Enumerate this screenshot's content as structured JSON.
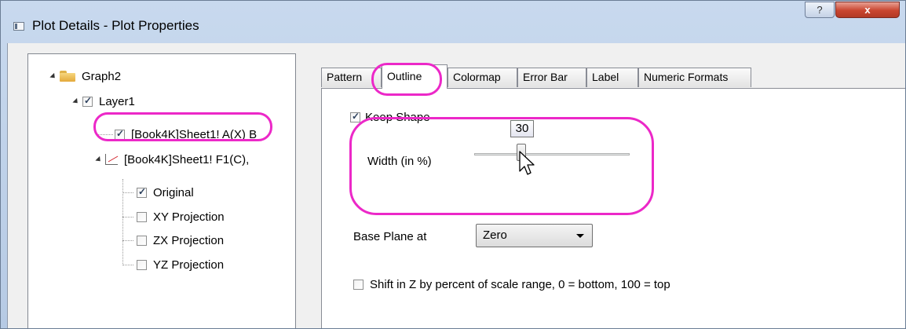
{
  "window": {
    "title": "Plot Details - Plot Properties",
    "help_label": "?",
    "close_label": "x"
  },
  "tree": {
    "nodes": [
      {
        "label": "Graph2",
        "icon": "folder-icon"
      },
      {
        "label": "Layer1",
        "checked": true
      },
      {
        "label": "[Book4K]Sheet1! A(X) B",
        "checked": true
      },
      {
        "label": "[Book4K]Sheet1! F1(C),",
        "icon": "line-plot-icon"
      },
      {
        "label": "Original",
        "checked": true
      },
      {
        "label": "XY Projection",
        "checked": false
      },
      {
        "label": "ZX Projection",
        "checked": false
      },
      {
        "label": "YZ Projection",
        "checked": false
      }
    ]
  },
  "tabs": [
    {
      "label": "Pattern",
      "active": false
    },
    {
      "label": "Outline",
      "active": true
    },
    {
      "label": "Colormap",
      "active": false
    },
    {
      "label": "Error Bar",
      "active": false
    },
    {
      "label": "Label",
      "active": false
    },
    {
      "label": "Numeric Formats",
      "active": false
    }
  ],
  "outline": {
    "keep_shape_label": "Keep Shape",
    "keep_shape_checked": true,
    "width_label": "Width (in %)",
    "width_value": "30",
    "base_plane_label": "Base Plane at",
    "base_plane_value": "Zero",
    "shift_label": "Shift in Z by percent of scale range, 0 = bottom, 100 = top",
    "shift_checked": false
  },
  "colors": {
    "highlight": "#ec28c8",
    "titlebar": "#c8d9ee",
    "close_button": "#c9452f"
  }
}
